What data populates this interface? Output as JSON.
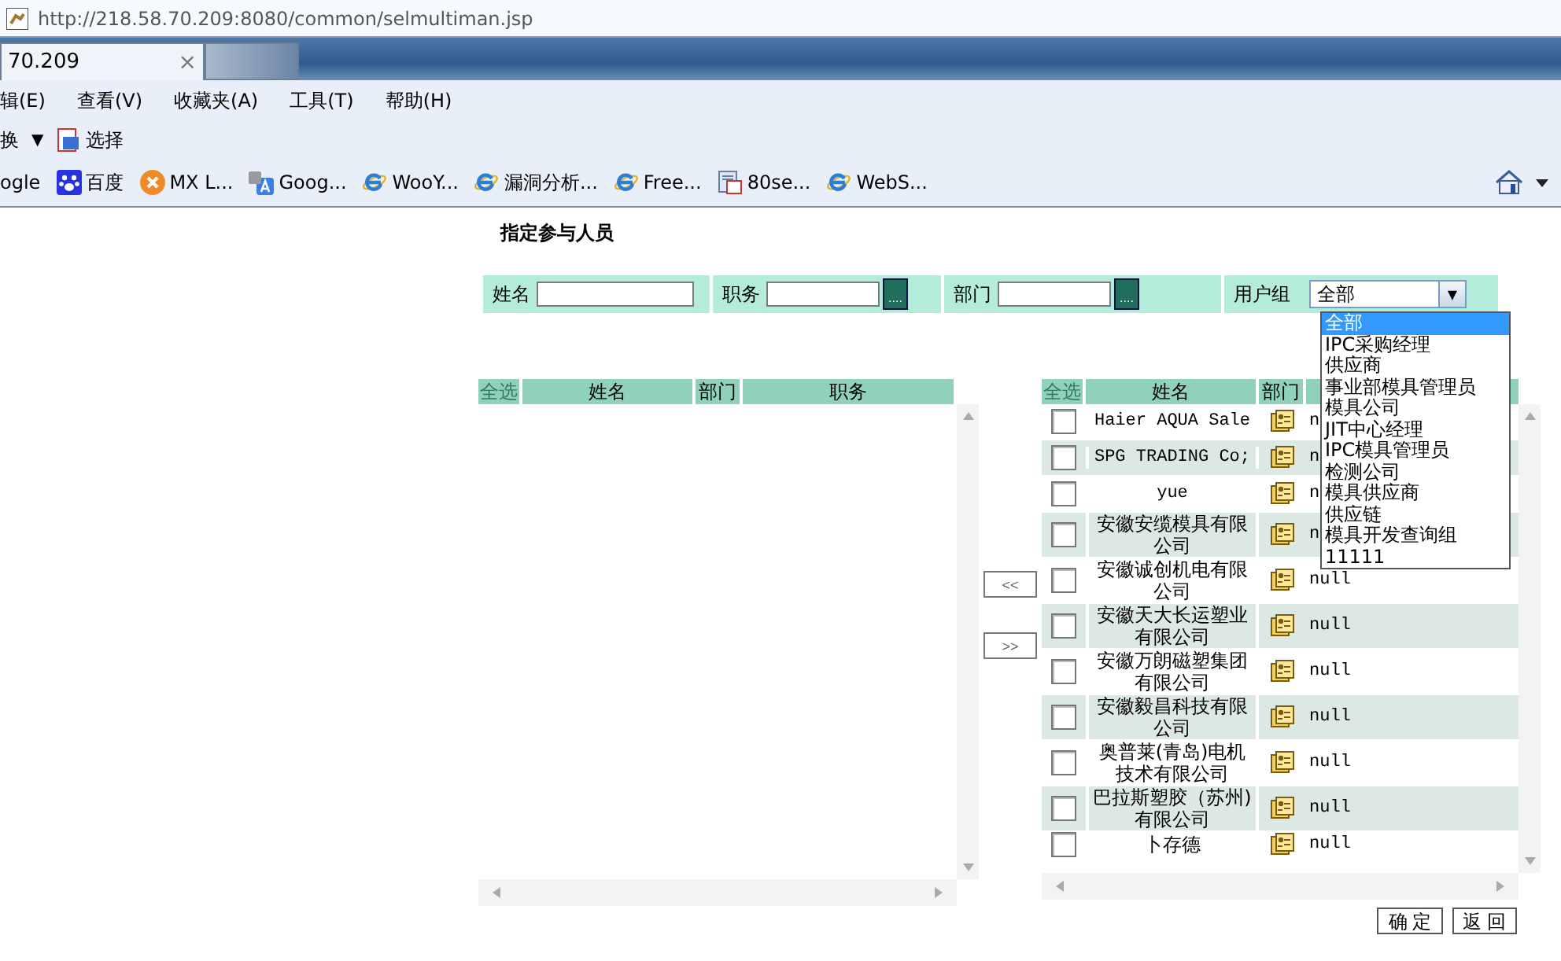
{
  "browser": {
    "address": "http://218.58.70.209:8080/common/selmultiman.jsp",
    "tabs": [
      {
        "label": "70.209",
        "close": "×",
        "selected": true
      }
    ],
    "menu": [
      "辑(E)",
      "查看(V)",
      "收藏夹(A)",
      "工具(T)",
      "帮助(H)"
    ],
    "command_bar": {
      "left": "换",
      "arrow": "▼",
      "select": "选择"
    },
    "favorites": [
      {
        "label": "ogle",
        "kind": "none"
      },
      {
        "label": "百度",
        "kind": "paw"
      },
      {
        "label": "MX L...",
        "kind": "xcircle"
      },
      {
        "label": "Goog...",
        "kind": "translate"
      },
      {
        "label": "WooY...",
        "kind": "ie"
      },
      {
        "label": "漏洞分析...",
        "kind": "ie"
      },
      {
        "label": "Free...",
        "kind": "ie"
      },
      {
        "label": "80se...",
        "kind": "sheet"
      },
      {
        "label": "WebS...",
        "kind": "ie"
      }
    ]
  },
  "page": {
    "title": "指定参与人员",
    "filters": [
      {
        "label": "姓名",
        "kind": "text"
      },
      {
        "label": "职务",
        "kind": "picker",
        "button": "...."
      },
      {
        "label": "部门",
        "kind": "picker",
        "button": "...."
      },
      {
        "label": "用户组",
        "kind": "select",
        "value": "全部"
      }
    ],
    "user_group_options": [
      {
        "label": "全部",
        "selected": true
      },
      {
        "label": "IPC采购经理",
        "selected": false
      },
      {
        "label": "供应商",
        "selected": false
      },
      {
        "label": "事业部模具管理员",
        "selected": false
      },
      {
        "label": "模具公司",
        "selected": false
      },
      {
        "label": "JIT中心经理",
        "selected": false
      },
      {
        "label": "IPC模具管理员",
        "selected": false
      },
      {
        "label": "检测公司",
        "selected": false
      },
      {
        "label": "模具供应商",
        "selected": false
      },
      {
        "label": "供应链",
        "selected": false
      },
      {
        "label": "模具开发查询组",
        "selected": false
      },
      {
        "label": "11111",
        "selected": false
      }
    ],
    "left_table": {
      "columns": [
        "全选",
        "姓名",
        "部门",
        "职务"
      ]
    },
    "move_buttons": [
      "<<",
      ">>"
    ],
    "right_table": {
      "columns": [
        "全选",
        "姓名",
        "部门"
      ],
      "rows": [
        {
          "name": "Haier AQUA Sale",
          "column_4": "n",
          "checked": false
        },
        {
          "name": "SPG TRADING Co;",
          "column_4": "n",
          "checked": false
        },
        {
          "name": "yue",
          "column_4": "n",
          "checked": false
        },
        {
          "name": "安徽安缆模具有限公司",
          "column_4": "n",
          "checked": false
        },
        {
          "name": "安徽诚创机电有限公司",
          "column_4": "null",
          "checked": false
        },
        {
          "name": "安徽天大长运塑业有限公司",
          "column_4": "null",
          "checked": false
        },
        {
          "name": "安徽万朗磁塑集团有限公司",
          "column_4": "null",
          "checked": false
        },
        {
          "name": "安徽毅昌科技有限公司",
          "column_4": "null",
          "checked": false
        },
        {
          "name": "奥普莱(青岛)电机技术有限公司",
          "column_4": "null",
          "checked": false
        },
        {
          "name": "巴拉斯塑胶（苏州)有限公司",
          "column_4": "null",
          "checked": false
        },
        {
          "name": "卜存德",
          "column_4": "null",
          "checked": false
        }
      ]
    },
    "footer_buttons": [
      "确 定",
      "返 回"
    ]
  }
}
